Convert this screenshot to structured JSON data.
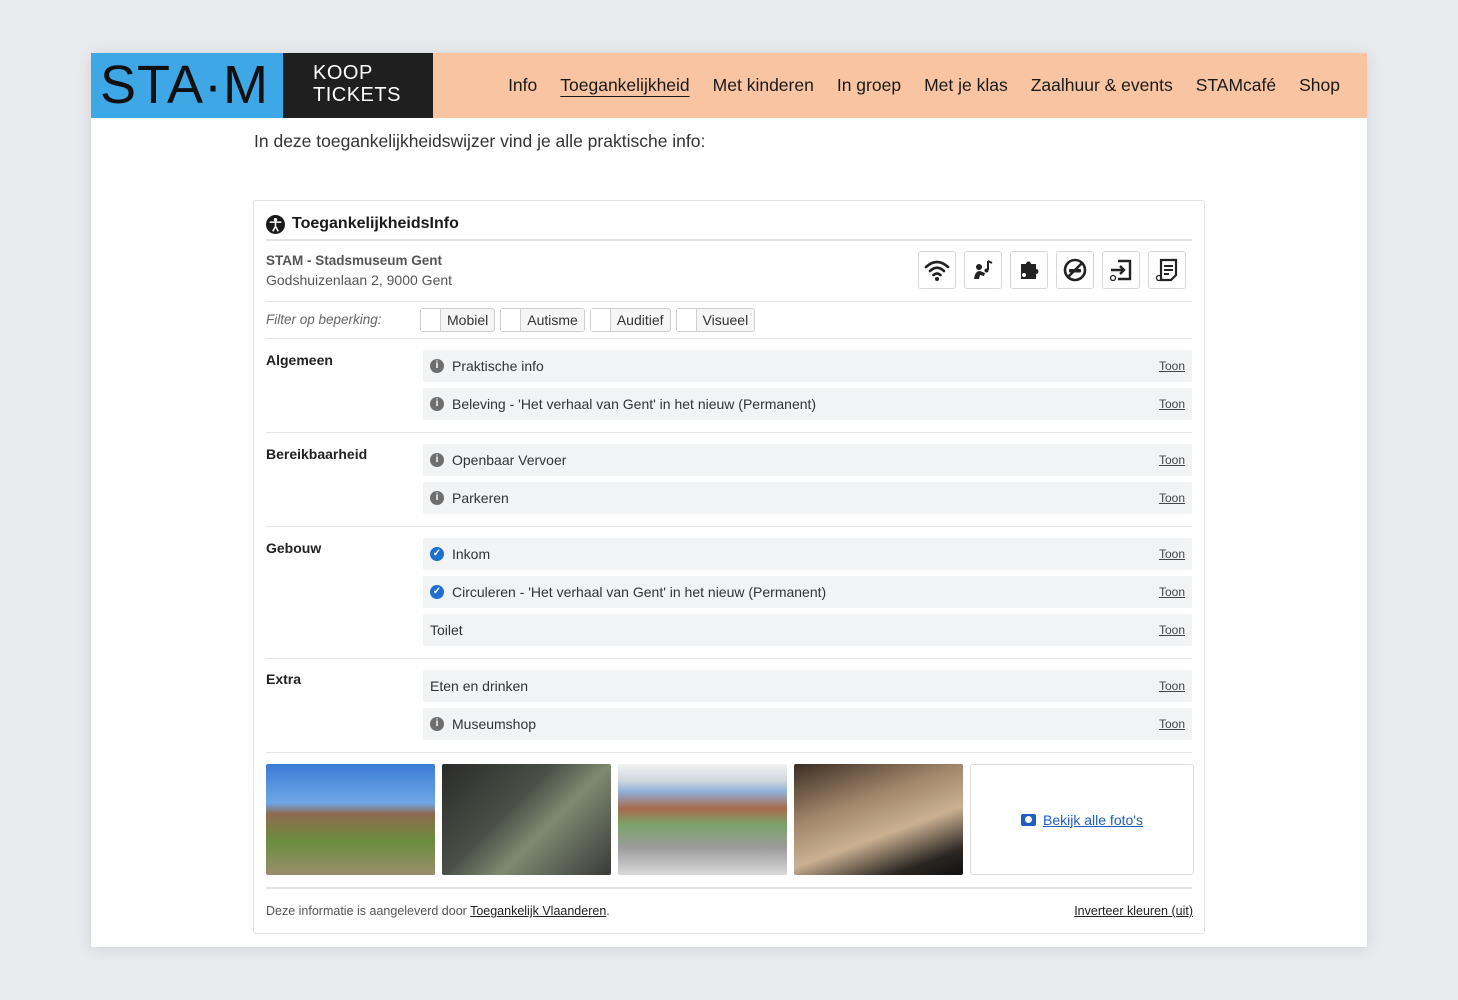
{
  "header": {
    "logo": "STA·M",
    "tickets": [
      "KOOP",
      "TICKETS"
    ],
    "nav": [
      "Info",
      "Toegankelijkheid",
      "Met kinderen",
      "In groep",
      "Met je klas",
      "Zaalhuur & events",
      "STAMcafé",
      "Shop"
    ],
    "active_nav": "Toegankelijkheid"
  },
  "intro": "In deze toegankelijkheidswijzer vind je alle praktische info:",
  "widget": {
    "title": "ToegankelijkheidsInfo",
    "venue_name": "STAM - Stadsmuseum Gent",
    "venue_address": "Godshuizenlaan 2, 9000 Gent",
    "feature_icons": [
      "wifi-icon",
      "audio-guide-icon",
      "autism-friendly-icon",
      "no-smoking-icon",
      "accessible-entrance-icon",
      "accessible-information-icon"
    ],
    "filter_label": "Filter op beperking:",
    "filters": [
      "Mobiel",
      "Autisme",
      "Auditief",
      "Visueel"
    ],
    "toon_label": "Toon",
    "categories": [
      {
        "name": "Algemeen",
        "items": [
          {
            "label": "Praktische info",
            "icon": "info"
          },
          {
            "label": "Beleving - 'Het verhaal van Gent' in het nieuw (Permanent)",
            "icon": "info"
          }
        ]
      },
      {
        "name": "Bereikbaarheid",
        "items": [
          {
            "label": "Openbaar Vervoer",
            "icon": "info"
          },
          {
            "label": "Parkeren",
            "icon": "info"
          }
        ]
      },
      {
        "name": "Gebouw",
        "items": [
          {
            "label": "Inkom",
            "icon": "check"
          },
          {
            "label": "Circuleren - 'Het verhaal van Gent' in het nieuw (Permanent)",
            "icon": "check"
          },
          {
            "label": "Toilet",
            "icon": "none"
          }
        ]
      },
      {
        "name": "Extra",
        "items": [
          {
            "label": "Eten en drinken",
            "icon": "none"
          },
          {
            "label": "Museumshop",
            "icon": "info"
          }
        ]
      }
    ],
    "all_photos_label": "Bekijk alle foto's",
    "footer_text": "Deze informatie is aangeleverd door",
    "footer_link": "Toegankelijk Vlaanderen",
    "footer_dot": ".",
    "invert_label": "Inverteer kleuren (uit)"
  }
}
